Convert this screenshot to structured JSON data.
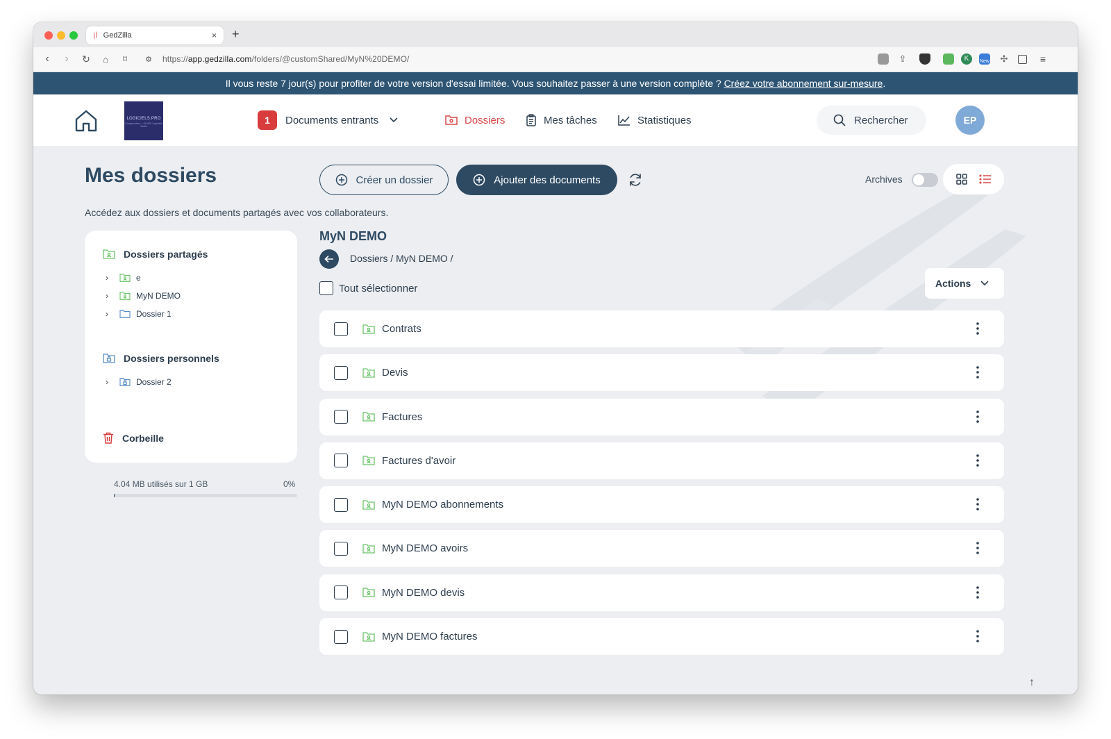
{
  "browser": {
    "tab_title": "GedZilla",
    "tab_close": "×",
    "new_tab": "+",
    "url_prefix": "https://",
    "url_host": "app.gedzilla.com",
    "url_path": "/folders/@customShared/MyN%20DEMO/",
    "ext_badge": "New"
  },
  "banner": {
    "text": "Il vous reste 7 jour(s) pour profiter de votre version d'essai limitée. Vous souhaitez passer à une version complète ? ",
    "link": "Créez votre abonnement sur-mesure",
    "suffix": "."
  },
  "header": {
    "logo_text": "LOGICIELS.PRO",
    "logo_sub": "Comparateur • 45 000 logiciels SaaS",
    "incoming_count": "1",
    "nav": {
      "incoming": "Documents entrants",
      "folders": "Dossiers",
      "tasks": "Mes tâches",
      "stats": "Statistiques"
    },
    "search": "Rechercher",
    "avatar": "EP"
  },
  "page": {
    "title": "Mes dossiers",
    "subtitle": "Accédez aux dossiers et documents partagés avec vos collaborateurs.",
    "create_folder": "Créer un dossier",
    "add_documents": "Ajouter des documents",
    "archives": "Archives"
  },
  "sidebar": {
    "shared_heading": "Dossiers partagés",
    "shared": [
      {
        "label": "e"
      },
      {
        "label": "MyN DEMO"
      },
      {
        "label": "Dossier 1"
      }
    ],
    "personal_heading": "Dossiers personnels",
    "personal": [
      {
        "label": "Dossier 2"
      }
    ],
    "trash": "Corbeille",
    "storage_text": "4.04 MB utilisés sur 1 GB",
    "storage_pct": "0%",
    "storage_fraction": 0.004
  },
  "folder": {
    "title": "MyN DEMO",
    "breadcrumb": "Dossiers / MyN DEMO /",
    "select_all": "Tout sélectionner",
    "actions": "Actions",
    "items": [
      {
        "name": "Contrats"
      },
      {
        "name": "Devis"
      },
      {
        "name": "Factures"
      },
      {
        "name": "Factures d'avoir"
      },
      {
        "name": "MyN DEMO abonnements"
      },
      {
        "name": "MyN DEMO avoirs"
      },
      {
        "name": "MyN DEMO devis"
      },
      {
        "name": "MyN DEMO factures"
      }
    ]
  },
  "colors": {
    "primary": "#2d4a62",
    "danger": "#d93c3c",
    "banner": "#2d5473",
    "folder_shared": "#6cc46a",
    "folder_personal": "#5a8fc6",
    "avatar": "#7fa9d6"
  }
}
